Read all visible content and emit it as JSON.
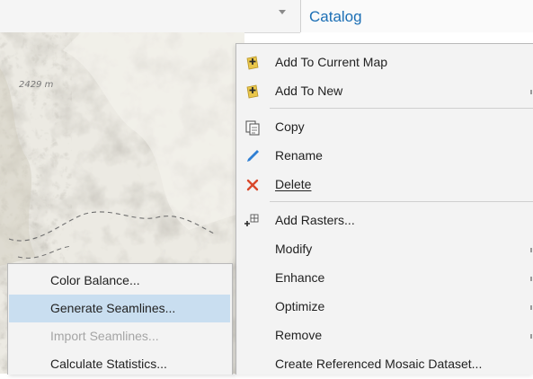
{
  "header": {
    "catalog_title": "Catalog"
  },
  "map": {
    "elevation_label": "2429 m"
  },
  "context_menu": {
    "items": [
      {
        "label": "Add To Current Map",
        "icon": "add-layer-icon",
        "submenu": false
      },
      {
        "label": "Add To New",
        "icon": "add-layer-icon",
        "submenu": true
      },
      {
        "label": "Copy",
        "icon": "copy-icon",
        "submenu": false
      },
      {
        "label": "Rename",
        "icon": "pencil-icon",
        "submenu": false
      },
      {
        "label": "Delete",
        "icon": "delete-x-icon",
        "submenu": false
      },
      {
        "label": "Add Rasters...",
        "icon": "add-rasters-icon",
        "submenu": false
      },
      {
        "label": "Modify",
        "icon": "",
        "submenu": true
      },
      {
        "label": "Enhance",
        "icon": "",
        "submenu": true
      },
      {
        "label": "Optimize",
        "icon": "",
        "submenu": true
      },
      {
        "label": "Remove",
        "icon": "",
        "submenu": true
      },
      {
        "label": "Create Referenced Mosaic Dataset...",
        "icon": "",
        "submenu": false
      }
    ]
  },
  "enhance_submenu": {
    "items": [
      {
        "label": "Color Balance...",
        "state": "normal"
      },
      {
        "label": "Generate Seamlines...",
        "state": "hover"
      },
      {
        "label": "Import Seamlines...",
        "state": "disabled"
      },
      {
        "label": "Calculate Statistics...",
        "state": "normal"
      }
    ]
  },
  "colors": {
    "accent": "#1c6fb5",
    "hover": "#c9def0",
    "delete": "#d9482b",
    "pencil": "#2f7fd3",
    "disabled_text": "#a5a5a5"
  }
}
